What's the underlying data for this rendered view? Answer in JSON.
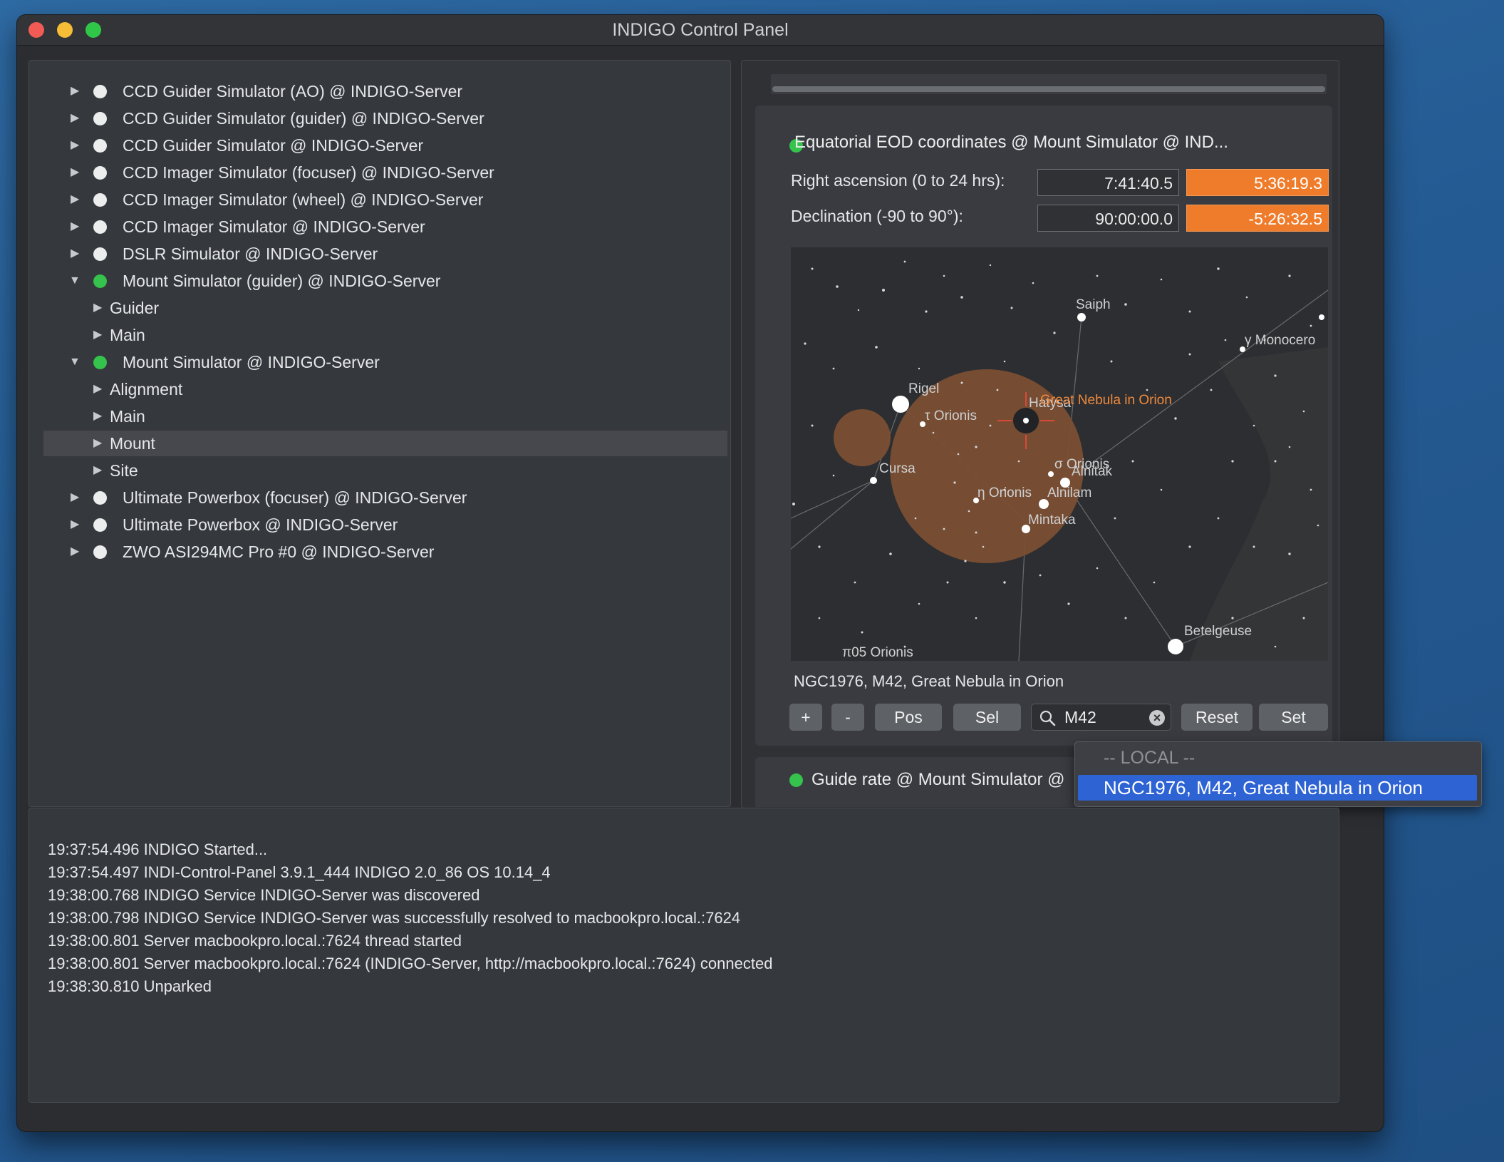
{
  "window": {
    "title": "INDIGO Control Panel"
  },
  "tree": [
    {
      "label": "CCD Guider Simulator (AO) @ INDIGO-Server",
      "status": "white",
      "expanded": false
    },
    {
      "label": "CCD Guider Simulator (guider) @ INDIGO-Server",
      "status": "white",
      "expanded": false
    },
    {
      "label": "CCD Guider Simulator @ INDIGO-Server",
      "status": "white",
      "expanded": false
    },
    {
      "label": "CCD Imager Simulator (focuser) @ INDIGO-Server",
      "status": "white",
      "expanded": false
    },
    {
      "label": "CCD Imager Simulator (wheel) @ INDIGO-Server",
      "status": "white",
      "expanded": false
    },
    {
      "label": "CCD Imager Simulator @ INDIGO-Server",
      "status": "white",
      "expanded": false
    },
    {
      "label": "DSLR Simulator @ INDIGO-Server",
      "status": "white",
      "expanded": false
    },
    {
      "label": "Mount Simulator (guider) @ INDIGO-Server",
      "status": "green",
      "expanded": true
    },
    {
      "label": "Guider",
      "child": true
    },
    {
      "label": "Main",
      "child": true
    },
    {
      "label": "Mount Simulator @ INDIGO-Server",
      "status": "green",
      "expanded": true
    },
    {
      "label": "Alignment",
      "child": true
    },
    {
      "label": "Main",
      "child": true
    },
    {
      "label": "Mount",
      "child": true,
      "selected": true
    },
    {
      "label": "Site",
      "child": true
    },
    {
      "label": "Ultimate Powerbox (focuser) @ INDIGO-Server",
      "status": "white",
      "expanded": false
    },
    {
      "label": "Ultimate Powerbox @ INDIGO-Server",
      "status": "white",
      "expanded": false
    },
    {
      "label": "ZWO ASI294MC Pro #0 @ INDIGO-Server",
      "status": "white",
      "expanded": false
    }
  ],
  "property": {
    "title": "Equatorial EOD coordinates @ Mount Simulator @ IND...",
    "ra_label": "Right ascension (0 to 24 hrs):",
    "ra_current": "7:41:40.5",
    "ra_target": "5:36:19.3",
    "dec_label": "Declination (-90 to 90°):",
    "dec_current": "90:00:00.0",
    "dec_target": "-5:26:32.5"
  },
  "skymap": {
    "labels": {
      "saiph": "Saiph",
      "monoceros": "γ Monocero",
      "rigel": "Rigel",
      "tau_orionis": "τ Orionis",
      "hatysa": "Hatysa",
      "great_nebula": "Great Nebula in Orion",
      "cursa": "Cursa",
      "sigma_orionis": "σ Orionis",
      "alnitak": "Alnitak",
      "eta_orionis": "η Orionis",
      "alnilam": "Alnilam",
      "mintaka": "Mintaka",
      "betelgeuse": "Betelgeuse",
      "pi5_orionis": "π05 Orionis"
    }
  },
  "object_name": "NGC1976, M42, Great Nebula in Orion",
  "buttons": {
    "zoom_in": "+",
    "zoom_out": "-",
    "pos": "Pos",
    "sel": "Sel",
    "reset": "Reset",
    "set": "Set"
  },
  "search": {
    "value": "M42"
  },
  "guide_rate": {
    "title": "Guide rate @ Mount Simulator @"
  },
  "dropdown": {
    "header": "-- LOCAL --",
    "item": "NGC1976, M42, Great Nebula in Orion"
  },
  "log": [
    "19:37:54.496 INDIGO Started...",
    "19:37:54.497 INDI-Control-Panel 3.9.1_444 INDIGO 2.0_86 OS 10.14_4",
    "19:38:00.768 INDIGO Service INDIGO-Server was discovered",
    "19:38:00.798 INDIGO Service INDIGO-Server was successfully resolved to macbookpro.local.:7624",
    "19:38:00.801 Server macbookpro.local.:7624 thread started",
    "19:38:00.801 Server macbookpro.local.:7624 (INDIGO-Server, http://macbookpro.local.:7624) connected",
    "19:38:30.810 Unparked"
  ],
  "colors": {
    "accent_orange": "#ef7c2b",
    "status_green": "#35c24d",
    "selection_blue": "#2e63d4"
  }
}
